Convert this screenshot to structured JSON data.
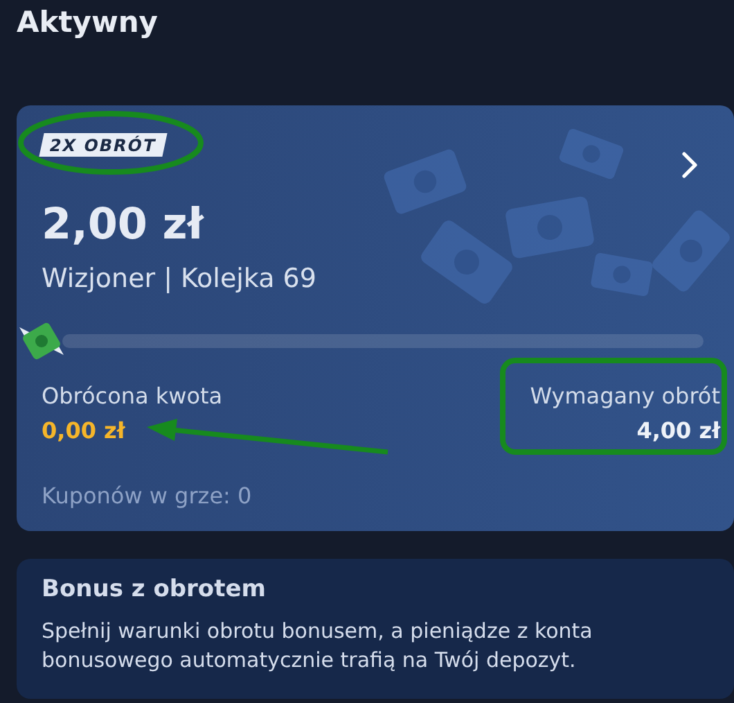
{
  "header": {
    "title": "Aktywny"
  },
  "bonus_card": {
    "badge": "2X OBRÓT",
    "amount": "2,00 zł",
    "source": "Wizjoner | Kolejka 69",
    "progress": {
      "level": 0
    },
    "turned_over": {
      "label": "Obrócona kwota",
      "value": "0,00 zł"
    },
    "required": {
      "label": "Wymagany obrót",
      "value": "4,00 zł"
    },
    "coupons": "Kuponów w grze: 0"
  },
  "info_card": {
    "title": "Bonus z obrotem",
    "text": "Spełnij warunki obrotu bonusem, a pieniądze z konta bonusowego automatycznie trafią na Twój depozyt."
  }
}
